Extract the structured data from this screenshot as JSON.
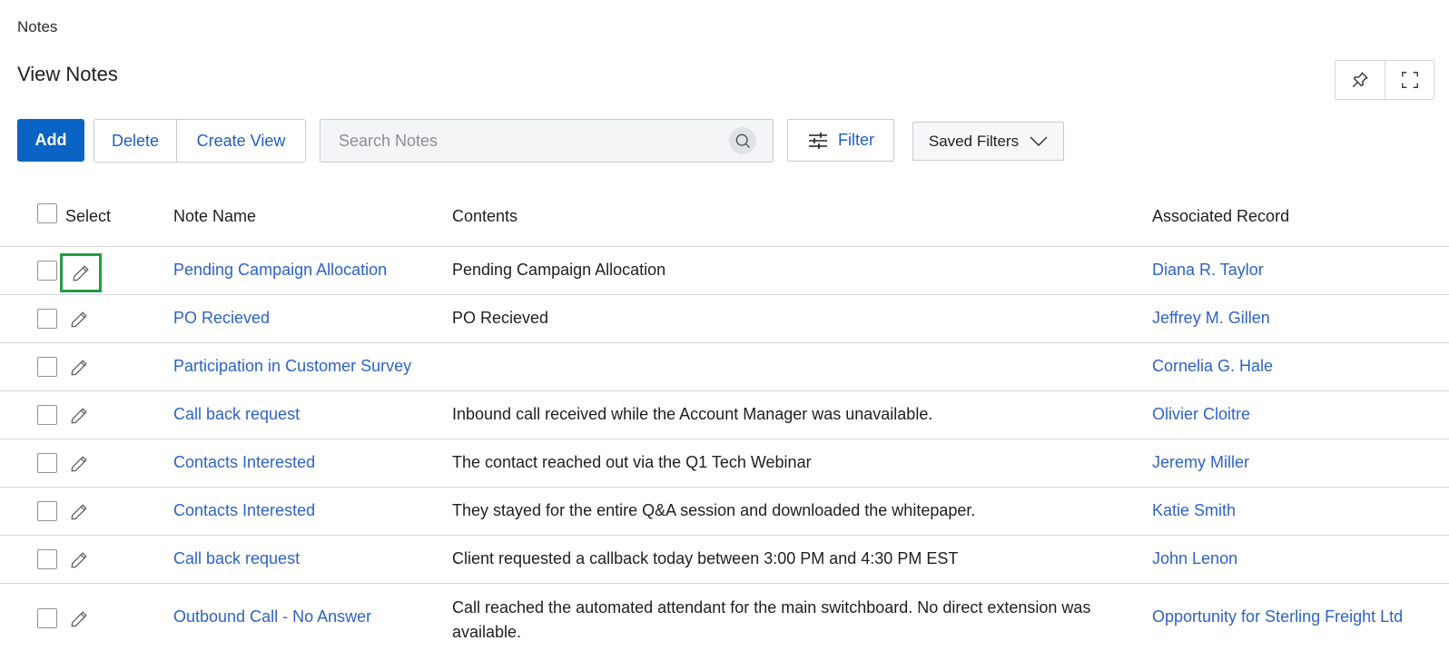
{
  "breadcrumb": "Notes",
  "page_title": "View Notes",
  "header_actions": {
    "pin_icon": "pin-icon",
    "expand_icon": "fullscreen-icon"
  },
  "toolbar": {
    "add_label": "Add",
    "delete_label": "Delete",
    "create_view_label": "Create View",
    "search_placeholder": "Search Notes",
    "search_value": "",
    "filter_label": "Filter",
    "saved_filters_label": "Saved Filters"
  },
  "table": {
    "columns": {
      "select": "Select",
      "note_name": "Note Name",
      "contents": "Contents",
      "associated_record": "Associated Record"
    },
    "rows": [
      {
        "name": "Pending Campaign Allocation",
        "contents": "Pending Campaign Allocation",
        "associated": "Diana R. Taylor"
      },
      {
        "name": "PO Recieved",
        "contents": "PO Recieved",
        "associated": "Jeffrey M. Gillen"
      },
      {
        "name": "Participation in Customer Survey",
        "contents": "",
        "associated": "Cornelia G. Hale"
      },
      {
        "name": "Call back request",
        "contents": "Inbound call received while the Account Manager was unavailable.",
        "associated": "Olivier Cloitre"
      },
      {
        "name": "Contacts Interested",
        "contents": "The contact reached out via the Q1 Tech Webinar",
        "associated": "Jeremy Miller"
      },
      {
        "name": "Contacts Interested",
        "contents": "They stayed for the entire Q&A session and downloaded the whitepaper.",
        "associated": "Katie Smith"
      },
      {
        "name": "Call back request",
        "contents": "Client requested a callback today between 3:00 PM and 4:30 PM EST",
        "associated": "John Lenon"
      },
      {
        "name": "Outbound Call - No Answer",
        "contents": "Call reached the automated attendant for the main switchboard. No direct extension was available.",
        "associated": "Opportunity for Sterling Freight Ltd"
      }
    ]
  },
  "colors": {
    "primary": "#0b63c4",
    "link": "#2e63c6",
    "focus_outline": "#1f9d45",
    "border": "#d6d8db"
  }
}
